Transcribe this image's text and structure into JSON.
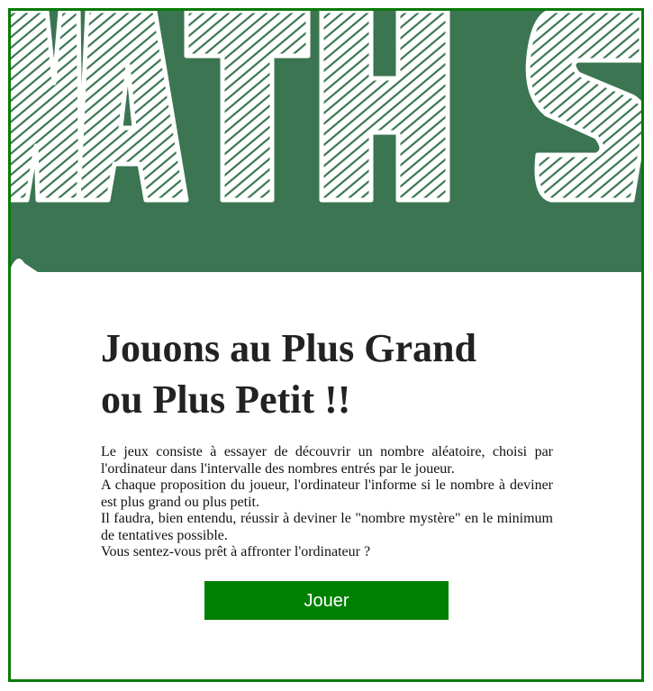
{
  "banner": {
    "logo_text": "MATHS",
    "colors": {
      "background": "#3b7551",
      "letter_fill": "#ffffff",
      "hatch": "#3b7551"
    }
  },
  "content": {
    "title_line1": "Jouons au Plus Grand",
    "title_line2": "ou Plus Petit !!",
    "desc_line1": "Le jeux consiste à essayer de découvrir un nombre aléatoire, choisi par l'ordinateur dans l'intervalle des nombres entrés par le joueur.",
    "desc_line2": "A chaque proposition du joueur, l'ordinateur l'informe si le nombre à deviner est plus grand ou plus petit.",
    "desc_line3": "Il faudra, bien entendu, réussir à deviner le \"nombre mystère\" en le minimum de tentatives possible.",
    "desc_line4": "Vous sentez-vous prêt à affronter l'ordinateur ?"
  },
  "actions": {
    "play_label": "Jouer",
    "play_color": "#008000",
    "border_color": "#0a7a0a"
  }
}
